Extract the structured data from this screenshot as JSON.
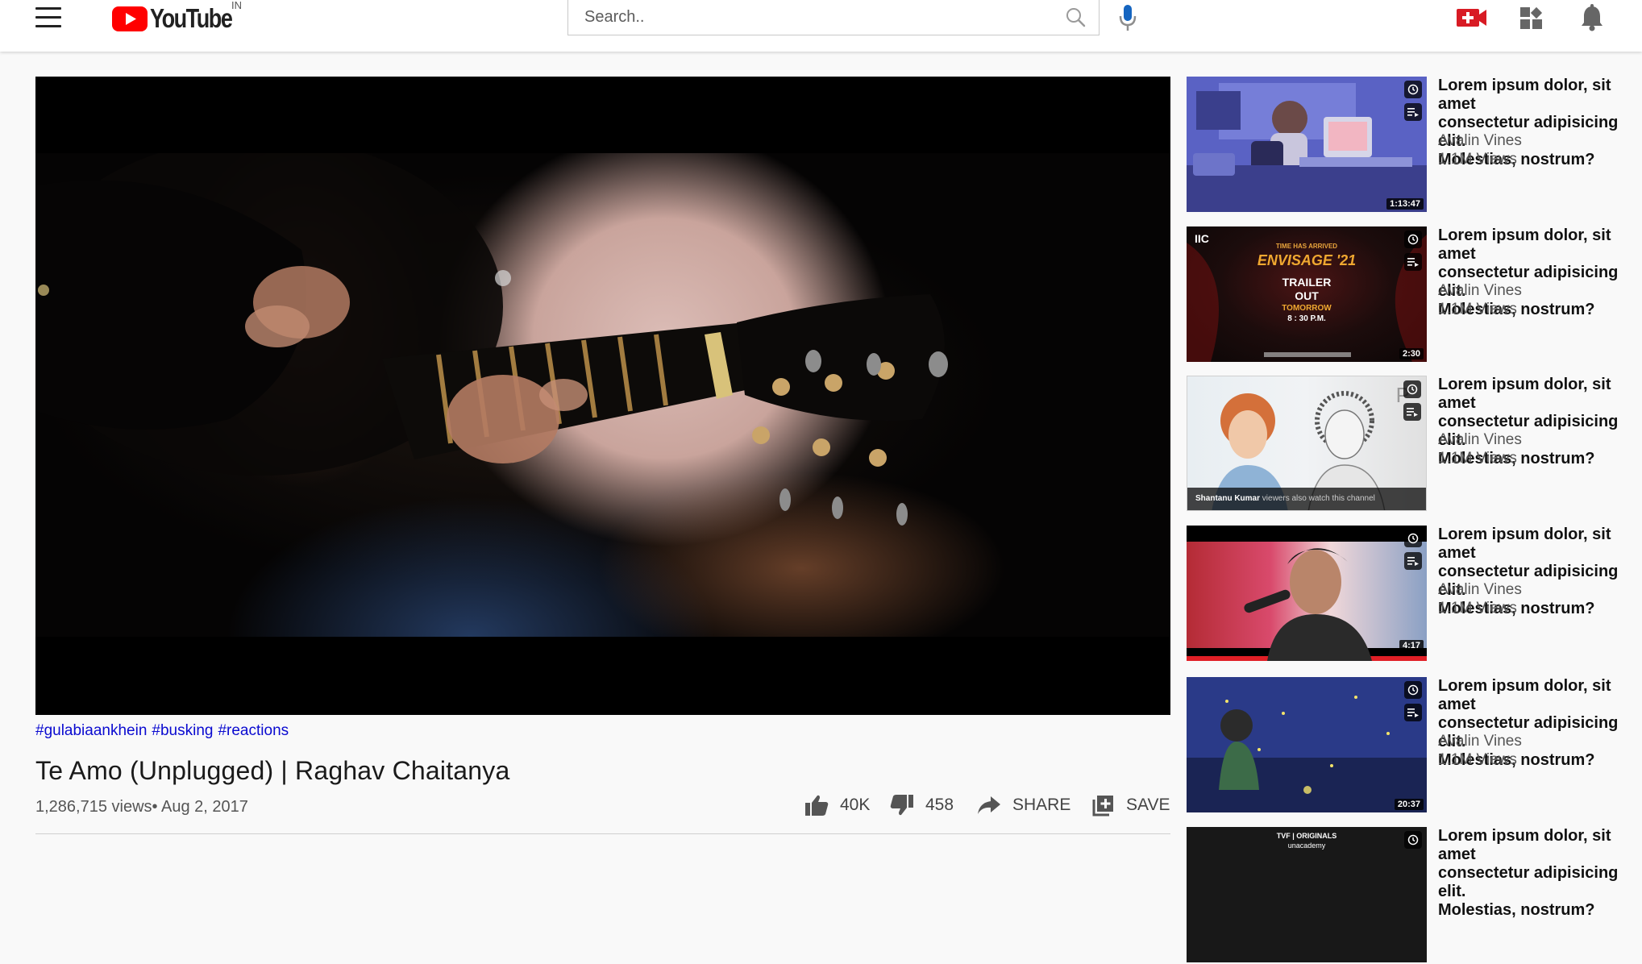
{
  "header": {
    "brand": "YouTube",
    "country": "IN",
    "search_placeholder": "Search..",
    "icons": [
      "menu-icon",
      "youtube-logo",
      "search-icon",
      "mic-icon",
      "create-video-icon",
      "apps-grid-icon",
      "notifications-bell-icon"
    ]
  },
  "player": {
    "scene": "close-up of a person playing an acoustic guitar, dark background"
  },
  "video": {
    "tags": [
      "#gulabiaankhein",
      "#busking",
      "#reactions"
    ],
    "title": "Te Amo (Unplugged) | Raghav Chaitanya",
    "meta": "1,286,715 views• Aug 2, 2017",
    "likes": "40K",
    "dislikes": "458",
    "share_label": "SHARE",
    "save_label": "SAVE"
  },
  "sidebar": {
    "items": [
      {
        "title": "Lorem ipsum dolor, sit amet\nconsectetur adipisicing elit.\nMolestias, nostrum?",
        "channel": "Avalin Vines",
        "views": "1.1M Views",
        "duration": "1:13:47"
      },
      {
        "title": "Lorem ipsum dolor, sit amet\nconsectetur adipisicing elit.\nMolestias, nostrum?",
        "channel": "Avalin Vines",
        "views": "1.1M Views",
        "duration": "2:30",
        "thumb_text": {
          "logo": "IIC",
          "line1": "TIME HAS ARRIVED",
          "line2": "ENVISAGE '21",
          "line3": "TRAILER",
          "line4": "OUT",
          "line5": "TOMORROW",
          "line6": "8 : 30 P.M."
        }
      },
      {
        "title": "Lorem ipsum dolor, sit amet\nconsectetur adipisicing elit.\nMolestias, nostrum?",
        "channel": "Avalin Vines",
        "views": "1.1M Views",
        "thumb_text": {
          "caption_name": "Shantanu Kumar",
          "caption_rest": " viewers also watch this channel",
          "corner": "P"
        }
      },
      {
        "title": "Lorem ipsum dolor, sit amet\nconsectetur adipisicing elit.\nMolestias, nostrum?",
        "channel": "Avalin Vines",
        "views": "1.1M Views",
        "duration": "4:17"
      },
      {
        "title": "Lorem ipsum dolor, sit amet\nconsectetur adipisicing elit.\nMolestias, nostrum?",
        "channel": "Avalin Vines",
        "views": "1.1M Views",
        "duration": "20:37"
      },
      {
        "title": "Lorem ipsum dolor, sit amet\nconsectetur adipisicing elit.\nMolestias, nostrum?",
        "channel": "",
        "views": "",
        "thumb_text": {
          "line1": "TVF | ORIGINALS",
          "line2": "unacademy"
        }
      }
    ]
  },
  "colors": {
    "brand_red": "#ff0000",
    "link_blue": "#0a0ad0",
    "mic_blue": "#1565c0",
    "background": "#f9f9f9"
  }
}
